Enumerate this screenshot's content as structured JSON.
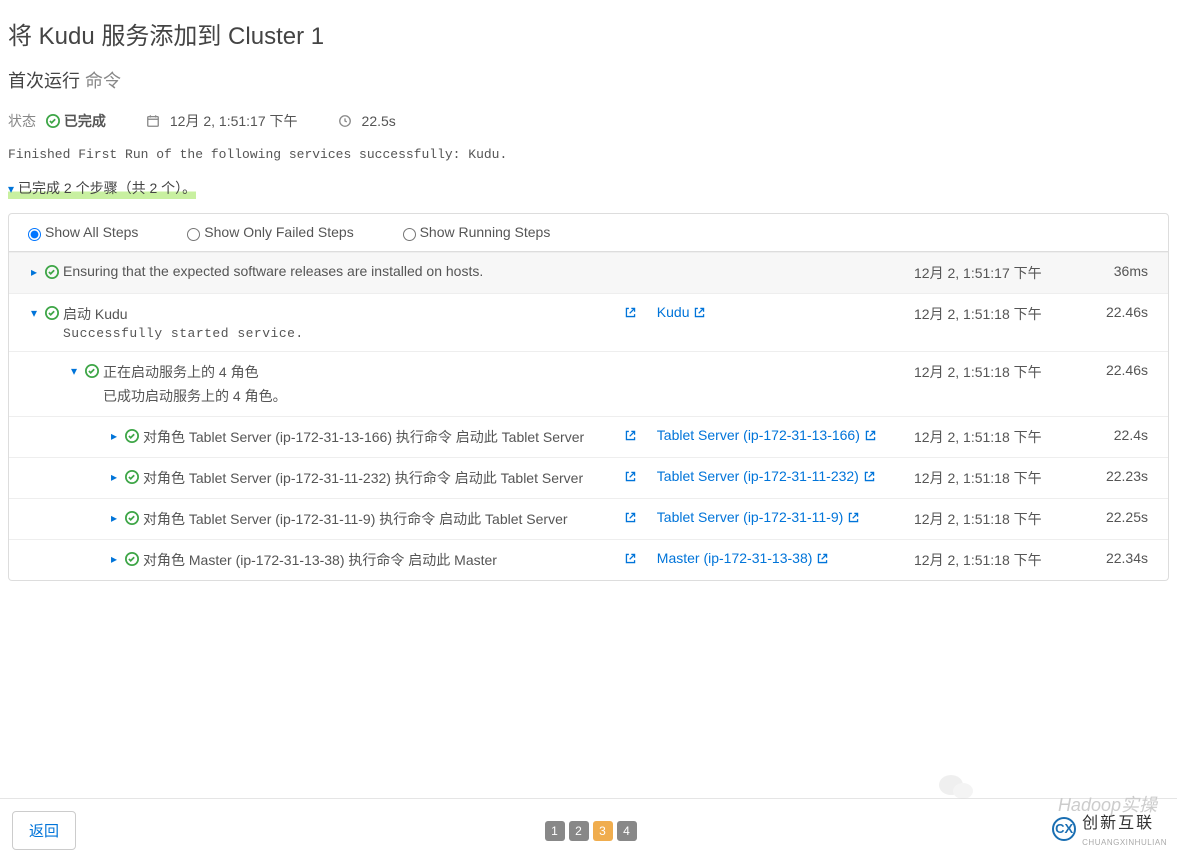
{
  "header": {
    "title": "将 Kudu 服务添加到 Cluster 1",
    "subtitle_bold": "首次运行",
    "subtitle_grey": "命令",
    "status_label": "状态",
    "status_value": "已完成",
    "timestamp": "12月 2, 1:51:17 下午",
    "duration": "22.5s",
    "finish_msg": "Finished First Run of the following services successfully: Kudu.",
    "steps_summary": "已完成 2 个步骤（共 2 个）。"
  },
  "filters": {
    "show_all": "Show All Steps",
    "show_failed": "Show Only Failed Steps",
    "show_running": "Show Running Steps"
  },
  "rows": [
    {
      "level": 0,
      "chev": "right",
      "grey": true,
      "desc": "Ensuring that the expected software releases are installed on hosts.",
      "time": "12月 2, 1:51:17 下午",
      "dur": "36ms"
    },
    {
      "level": 0,
      "chev": "down",
      "desc": "启动 Kudu",
      "mono": "Successfully started service.",
      "link": "Kudu",
      "time": "12月 2, 1:51:18 下午",
      "dur": "22.46s"
    },
    {
      "level": 1,
      "chev": "down",
      "desc": "正在启动服务上的 4 角色",
      "sub": "已成功启动服务上的 4 角色。",
      "time": "12月 2, 1:51:18 下午",
      "dur": "22.46s"
    },
    {
      "level": 2,
      "chev": "right",
      "desc": "对角色 Tablet Server (ip-172-31-13-166) 执行命令 启动此 Tablet Server",
      "link": "Tablet Server (ip-172-31-13-166)",
      "time": "12月 2, 1:51:18 下午",
      "dur": "22.4s"
    },
    {
      "level": 2,
      "chev": "right",
      "desc": "对角色 Tablet Server (ip-172-31-11-232) 执行命令 启动此 Tablet Server",
      "link": "Tablet Server (ip-172-31-11-232)",
      "time": "12月 2, 1:51:18 下午",
      "dur": "22.23s"
    },
    {
      "level": 2,
      "chev": "right",
      "desc": "对角色 Tablet Server (ip-172-31-11-9) 执行命令 启动此 Tablet Server",
      "link": "Tablet Server (ip-172-31-11-9)",
      "time": "12月 2, 1:51:18 下午",
      "dur": "22.25s"
    },
    {
      "level": 2,
      "chev": "right",
      "desc": "对角色 Master (ip-172-31-13-38) 执行命令 启动此 Master",
      "link": "Master (ip-172-31-13-38)",
      "time": "12月 2, 1:51:18 下午",
      "dur": "22.34s"
    }
  ],
  "footer": {
    "back": "返回",
    "pages": [
      "1",
      "2",
      "3",
      "4"
    ],
    "active_page": "3"
  },
  "watermark": "Hadoop实操",
  "brand": {
    "name": "创新互联",
    "sub": "CHUANGXINHULIAN"
  }
}
